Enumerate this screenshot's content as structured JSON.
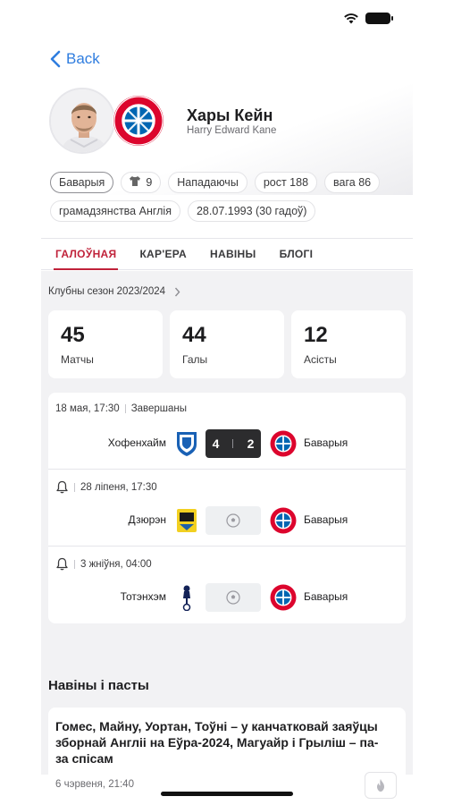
{
  "nav": {
    "back_label": "Back"
  },
  "player": {
    "name": "Хары Кейн",
    "full_name": "Harry Edward Kane"
  },
  "chips": {
    "club": "Баварыя",
    "number": "9",
    "position": "Нападаючы",
    "height": "рост 188",
    "weight": "вага 86",
    "citizenship": "грамадзянства Англія",
    "birth": "28.07.1993 (30 гадоў)"
  },
  "tabs": [
    {
      "label": "ГАЛОЎНАЯ",
      "active": true
    },
    {
      "label": "КАР'ЕРА",
      "active": false
    },
    {
      "label": "НАВІНЫ",
      "active": false
    },
    {
      "label": "БЛОГІ",
      "active": false
    }
  ],
  "season": {
    "label": "Клубны сезон 2023/2024",
    "stats": [
      {
        "value": "45",
        "label": "Матчы"
      },
      {
        "value": "44",
        "label": "Галы"
      },
      {
        "value": "12",
        "label": "Асісты"
      }
    ]
  },
  "matches": [
    {
      "date": "18 мая, 17:30",
      "status": "Завершаны",
      "home": "Хофенхайм",
      "away": "Баварыя",
      "score_home": "4",
      "score_away": "2"
    },
    {
      "date": "28 ліпеня, 17:30",
      "home": "Дзюрэн",
      "away": "Баварыя"
    },
    {
      "date": "3 жніўня, 04:00",
      "home": "Тотэнхэм",
      "away": "Баварыя"
    }
  ],
  "news": {
    "section_title": "Навіны і пасты",
    "headline": "Гомес, Майну, Уортан, Тоўні – у канчатковай заяўцы зборнай Англіі на Еўра-2024, Магуайр і Грыліш – па-за спісам",
    "date": "6 чэрвеня, 21:40"
  },
  "colors": {
    "accent": "#c0223a",
    "link": "#2f7ddf",
    "bayern_red": "#dc052d",
    "bayern_blue": "#0066b2"
  }
}
